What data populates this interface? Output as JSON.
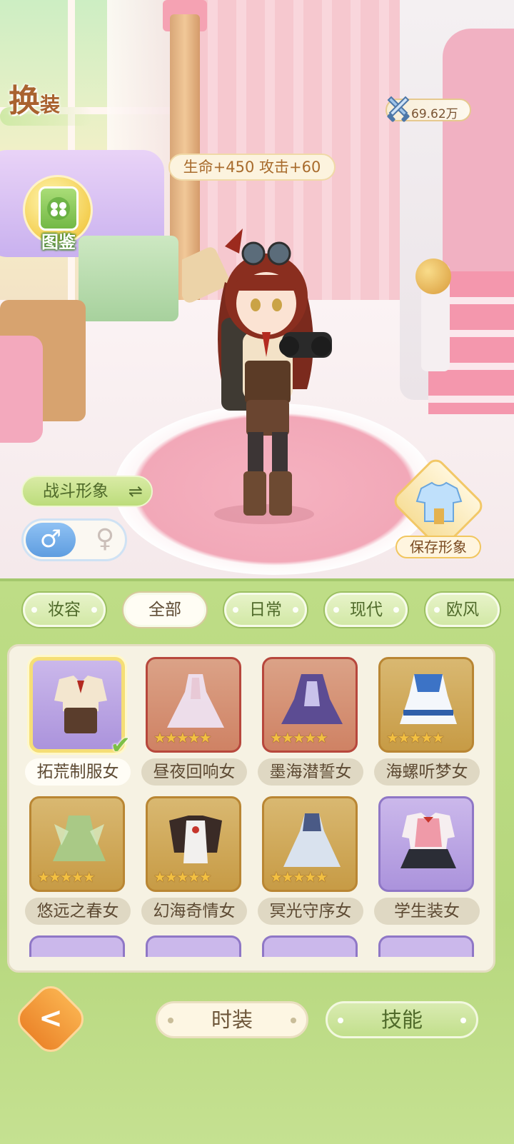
{
  "title": {
    "main": "换",
    "sub": "装"
  },
  "power": {
    "value": "69.62万"
  },
  "stats": {
    "text": "生命+450 攻击+60"
  },
  "codex": {
    "label": "图鉴"
  },
  "battle_look": {
    "label": "战斗形象",
    "icon": "swap-arrows-icon"
  },
  "gender": {
    "male": "♂",
    "female": "♀",
    "selected": "male"
  },
  "save_look": {
    "label": "保存形象"
  },
  "tabs": [
    {
      "label": "妆容",
      "active": false
    },
    {
      "label": "全部",
      "active": true
    },
    {
      "label": "日常",
      "active": false
    },
    {
      "label": "现代",
      "active": false
    },
    {
      "label": "欧风",
      "active": false
    }
  ],
  "outfits": [
    {
      "name": "拓荒制服女",
      "stars": "",
      "frame": "purple",
      "selected": true,
      "owned": true
    },
    {
      "name": "昼夜回响女",
      "stars": "★★★★★",
      "frame": "red",
      "selected": false
    },
    {
      "name": "墨海潜誓女",
      "stars": "★★★★★",
      "frame": "red",
      "selected": false
    },
    {
      "name": "海螺听梦女",
      "stars": "★★★★★",
      "frame": "gold",
      "selected": false
    },
    {
      "name": "悠远之春女",
      "stars": "★★★★★",
      "frame": "gold",
      "selected": false
    },
    {
      "name": "幻海奇情女",
      "stars": "★★★★★",
      "frame": "gold",
      "selected": false
    },
    {
      "name": "冥光守序女",
      "stars": "★★★★★",
      "frame": "gold",
      "selected": false
    },
    {
      "name": "学生装女",
      "stars": "",
      "frame": "purple",
      "selected": false
    }
  ],
  "bottom_tabs": {
    "fashion": "时装",
    "skills": "技能"
  },
  "back": {
    "icon": "back-arrow-icon",
    "glyph": "<"
  },
  "colors": {
    "panel_green": "#bedd86",
    "accent_gold": "#f3c041",
    "tab_text": "#4f6a2a"
  }
}
